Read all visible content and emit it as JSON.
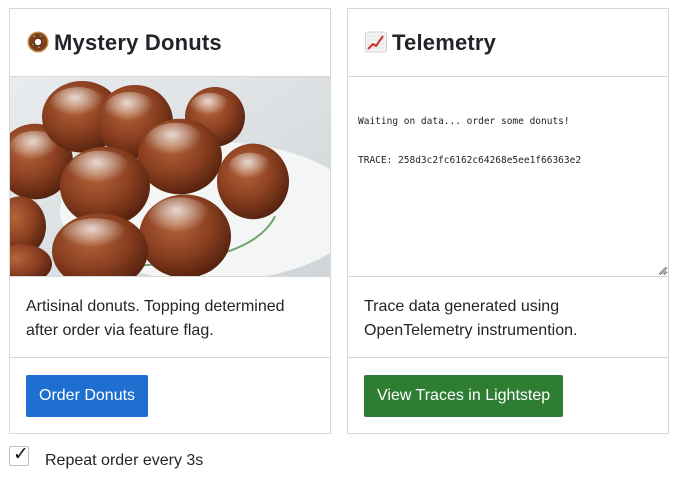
{
  "donuts_card": {
    "title": "Mystery Donuts",
    "title_icon": "donut-emoji",
    "image_alt": "donuts-photo",
    "description": "Artisinal donuts. Topping determined after order via feature flag.",
    "order_button_label": "Order Donuts"
  },
  "telemetry_card": {
    "title": "Telemetry",
    "title_icon": "chart-increasing-emoji",
    "log_lines": [
      "Waiting on data... order some donuts!",
      "TRACE: 258d3c2fc6162c64268e5ee1f66363e2"
    ],
    "description": "Trace data generated using OpenTelemetry instrumention.",
    "traces_button_label": "View Traces in Lightstep"
  },
  "repeat_order": {
    "checked": true,
    "check_glyph": "✓",
    "label": "Repeat order every 3s"
  },
  "colors": {
    "primary_button": "#1f6fd1",
    "success_button": "#2d7d32",
    "border": "#d7d7d7"
  }
}
